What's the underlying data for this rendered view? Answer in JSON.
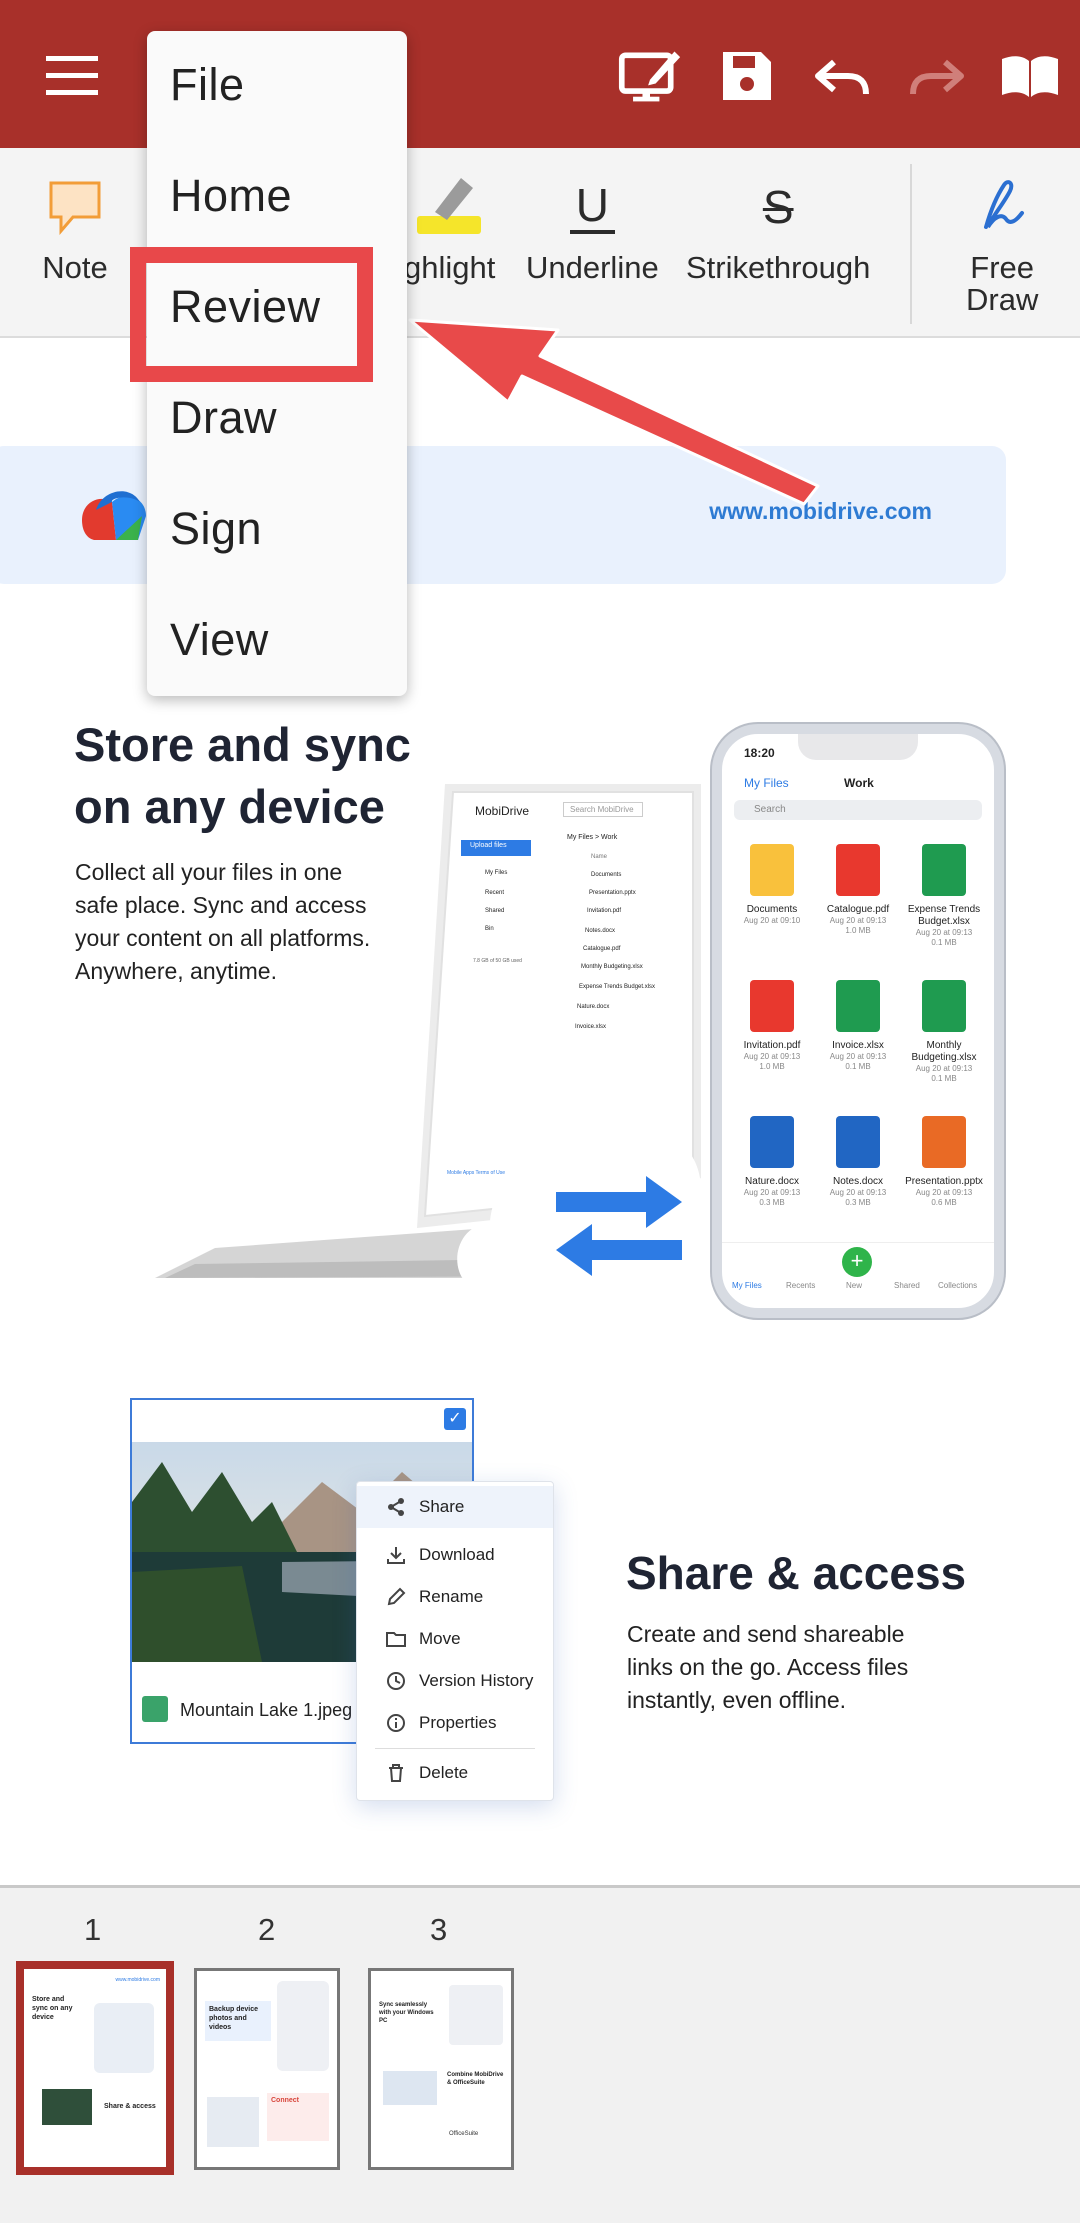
{
  "app_bar": {
    "icons": [
      "menu-icon",
      "present-icon",
      "save-icon",
      "undo-icon",
      "redo-icon",
      "read-mode-icon"
    ],
    "colors": {
      "bar": "#a8302a",
      "icon": "#ffffff",
      "redo_disabled": "#d07f7a"
    }
  },
  "ribbon": {
    "tools": {
      "note": "Note",
      "highlight": "ghlight",
      "underline": "Underline",
      "strikethrough": "Strikethrough",
      "free_draw": "Free\nDraw"
    },
    "glyphs": {
      "underline": "U",
      "strikethrough": "S"
    }
  },
  "menu": {
    "items": [
      "File",
      "Home",
      "Review",
      "Draw",
      "Sign",
      "View"
    ],
    "highlighted": "Review"
  },
  "document": {
    "banner_url": "www.mobidrive.com",
    "section1": {
      "title_line1": "Store and sync",
      "title_line2": "on any device",
      "body": [
        "Collect all your files in one",
        "safe place. Sync and access",
        "your content on all platforms.",
        "Anywhere, anytime."
      ]
    },
    "laptop": {
      "logo": "MobiDrive",
      "search": "Search MobiDrive",
      "upload": "Upload files",
      "sidebar": [
        "My Files",
        "Recent",
        "Shared",
        "Bin"
      ],
      "breadcrumb": "My Files  >  Work",
      "col_name": "Name",
      "files": [
        "Documents",
        "Presentation.pptx",
        "Invitation.pdf",
        "Notes.docx",
        "Catalogue.pdf",
        "Monthly Budgeting.xlsx",
        "Expense Trends Budget.xlsx",
        "Nature.docx",
        "Invoice.xlsx"
      ],
      "storage": "7.8 GB of 50 GB used",
      "footer": "Mobile Apps   Terms of Use"
    },
    "phone": {
      "time": "18:20",
      "back": "My Files",
      "folder": "Work",
      "search": "Search",
      "files": [
        {
          "name": "Documents",
          "date": "Aug 20 at 09:10",
          "size": "",
          "kind": "folder"
        },
        {
          "name": "Catalogue.pdf",
          "date": "Aug 20 at 09:13",
          "size": "1.0 MB",
          "kind": "pdf"
        },
        {
          "name": "Expense Trends Budget.xlsx",
          "date": "Aug 20 at 09:13",
          "size": "0.1 MB",
          "kind": "xlsx"
        },
        {
          "name": "Invitation.pdf",
          "date": "Aug 20 at 09:13",
          "size": "1.0 MB",
          "kind": "pdf"
        },
        {
          "name": "Invoice.xlsx",
          "date": "Aug 20 at 09:13",
          "size": "0.1 MB",
          "kind": "xlsx"
        },
        {
          "name": "Monthly Budgeting.xlsx",
          "date": "Aug 20 at 09:13",
          "size": "0.1 MB",
          "kind": "xlsx"
        },
        {
          "name": "Nature.docx",
          "date": "Aug 20 at 09:13",
          "size": "0.3 MB",
          "kind": "docx"
        },
        {
          "name": "Notes.docx",
          "date": "Aug 20 at 09:13",
          "size": "0.3 MB",
          "kind": "docx"
        },
        {
          "name": "Presentation.pptx",
          "date": "Aug 20 at 09:13",
          "size": "0.6 MB",
          "kind": "pptx"
        }
      ],
      "tabs": [
        "My Files",
        "Recents",
        "New",
        "Shared",
        "Collections"
      ]
    },
    "section2": {
      "title": "Share & access",
      "body": [
        "Create and send shareable",
        "links on the go. Access files",
        "instantly, even offline."
      ]
    },
    "photo_card": {
      "caption": "Mountain Lake 1.jpeg"
    },
    "context_menu": [
      "Share",
      "Download",
      "Rename",
      "Move",
      "Version History",
      "Properties",
      "Delete"
    ]
  },
  "thumbnails": {
    "pages": [
      "1",
      "2",
      "3"
    ],
    "selected": "1",
    "page1": {
      "title": "Store and sync on any device",
      "share": "Share & access",
      "url": "www.mobidrive.com"
    },
    "page2": {
      "title": "Backup device photos and videos",
      "connect": "Connect"
    },
    "page3": {
      "title": "Sync seamlessly with your Windows PC",
      "combine": "Combine MobiDrive & OfficeSuite",
      "brand": "OfficeSuite"
    }
  }
}
